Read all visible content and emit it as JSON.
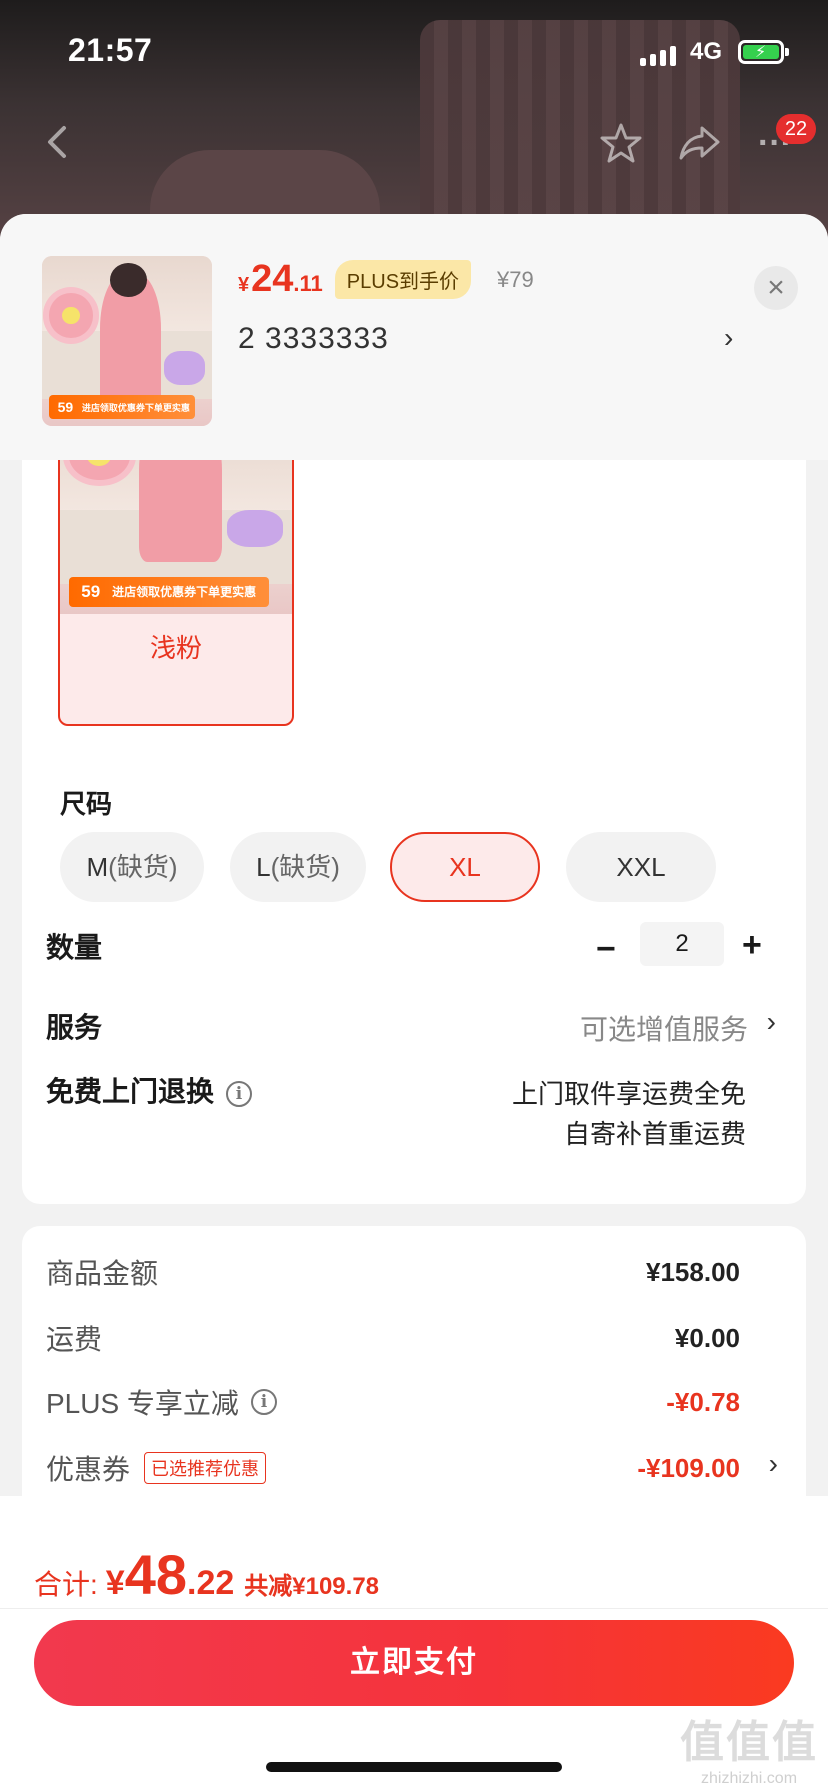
{
  "status_bar": {
    "time": "21:57",
    "network": "4G",
    "battery_level": 1.0
  },
  "nav": {
    "back_icon": "back-arrow-icon",
    "fav_icon": "star-icon",
    "share_icon": "share-icon",
    "more_label": "···",
    "badge": "22"
  },
  "sheet_header": {
    "price_currency": "¥",
    "price_int": "24",
    "price_dec": ".11",
    "plus_badge": "PLUS到手价",
    "original_price": "¥79",
    "spec_text": "2  3333333",
    "spec_chevron": "›",
    "close_label": "×",
    "thumb_tag_num": "59",
    "thumb_tag_text": "进店领取优惠券下单更实惠"
  },
  "color": {
    "tag_num": "59",
    "tag_text": "进店领取优惠券下单更实惠",
    "selected_label": "浅粉"
  },
  "size": {
    "title": "尺码",
    "options": [
      {
        "name": "M",
        "note": "(缺货)"
      },
      {
        "name": "L",
        "note": "(缺货)"
      },
      {
        "name": "XL",
        "note": ""
      },
      {
        "name": "XXL",
        "note": ""
      }
    ],
    "selected": "XL"
  },
  "quantity": {
    "label": "数量",
    "minus": "−",
    "value": "2",
    "plus": "+"
  },
  "service": {
    "label": "服务",
    "value": "可选增值服务",
    "chevron": "›"
  },
  "return": {
    "label": "免费上门退换",
    "info": "i",
    "line1": "上门取件享运费全免",
    "line2": "自寄补首重运费"
  },
  "fees": {
    "goods_label": "商品金额",
    "goods_value": "¥158.00",
    "shipping_label": "运费",
    "shipping_value": "¥0.00",
    "plus_label": "PLUS 专享立减",
    "plus_info": "i",
    "plus_value": "-¥0.78",
    "coupon_label": "优惠券",
    "coupon_tag": "已选推荐优惠",
    "coupon_value": "-¥109.00",
    "coupon_chevron": "›"
  },
  "footer": {
    "total_label": "合计:",
    "total_currency": "¥",
    "total_int": "48",
    "total_dec": ".22",
    "saving": "共减¥109.78",
    "pay_label": "立即支付",
    "watermark_big": "值值值",
    "watermark_small": "zhizhizhi.com"
  },
  "colors": {
    "accent": "#e8341f",
    "pay_start": "#f2394e",
    "pay_end": "#fa3a20",
    "plus_badge_bg": "#fbe7a7"
  }
}
